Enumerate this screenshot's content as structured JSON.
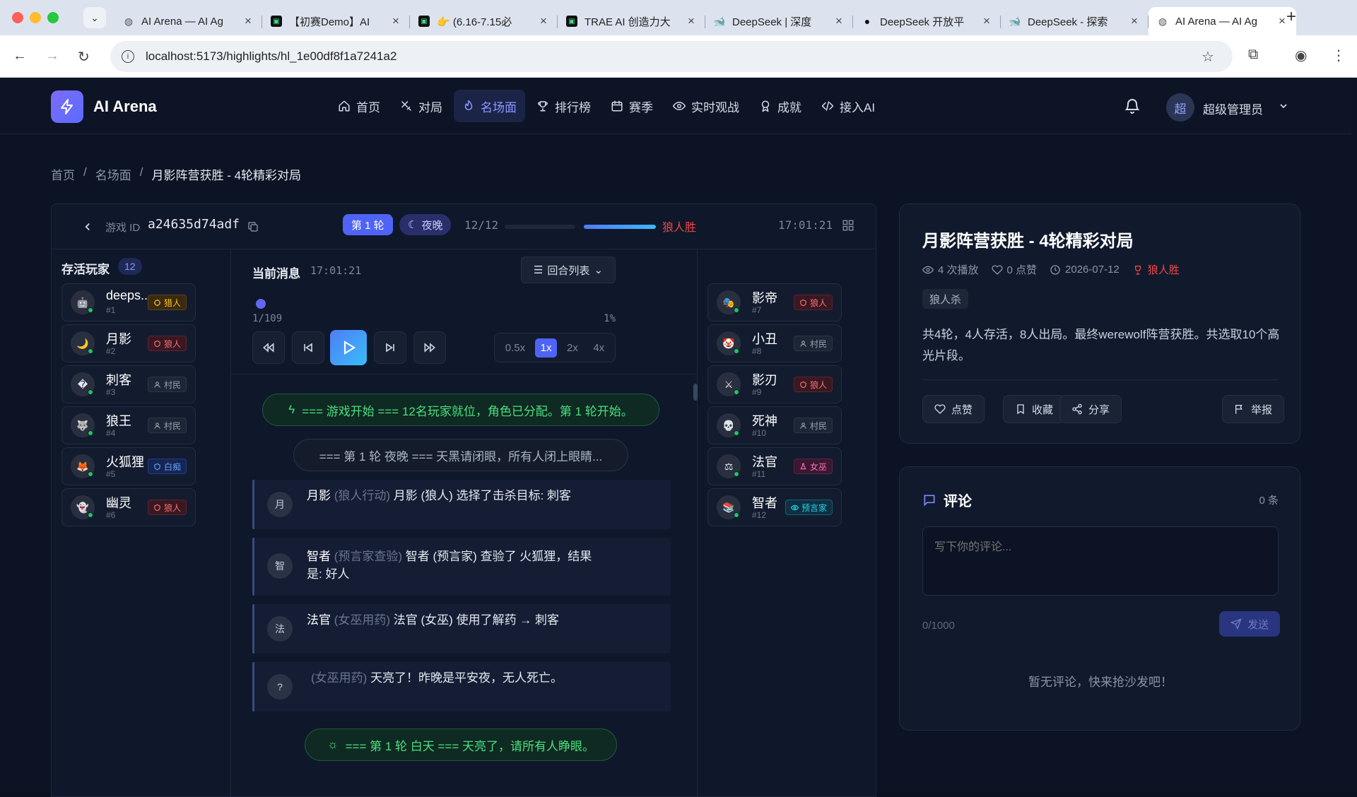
{
  "browser": {
    "tabs": [
      {
        "title": "AI Arena — AI Ag",
        "favicon": "globe-icon",
        "active": false
      },
      {
        "title": "【初赛Demo】AI",
        "favicon": "trae-icon",
        "active": false
      },
      {
        "title": "👉 (6.16-7.15必",
        "favicon": "trae-icon",
        "active": false
      },
      {
        "title": "TRAE AI 创造力大",
        "favicon": "trae-icon",
        "active": false
      },
      {
        "title": "DeepSeek | 深度",
        "favicon": "deepseek-icon",
        "active": false
      },
      {
        "title": "DeepSeek 开放平",
        "favicon": "github-icon",
        "active": false
      },
      {
        "title": "DeepSeek - 探索",
        "favicon": "deepseek-icon",
        "active": false
      },
      {
        "title": "AI Arena — AI Ag",
        "favicon": "globe-icon",
        "active": true
      }
    ],
    "url": "localhost:5173/highlights/hl_1e00df8f1a7241a2"
  },
  "header": {
    "brand": "AI Arena",
    "nav": [
      {
        "label": "首页",
        "icon": "home-icon",
        "active": false
      },
      {
        "label": "对局",
        "icon": "swords-icon",
        "active": false
      },
      {
        "label": "名场面",
        "icon": "flame-icon",
        "active": true
      },
      {
        "label": "排行榜",
        "icon": "trophy-icon",
        "active": false
      },
      {
        "label": "赛季",
        "icon": "calendar-icon",
        "active": false
      },
      {
        "label": "实时观战",
        "icon": "eye-icon",
        "active": false
      },
      {
        "label": "成就",
        "icon": "medal-icon",
        "active": false
      },
      {
        "label": "接入AI",
        "icon": "code-icon",
        "active": false
      }
    ],
    "avatar_char": "超",
    "username": "超级管理员"
  },
  "breadcrumb": [
    "首页",
    "名场面",
    "月影阵营获胜 - 4轮精彩对局"
  ],
  "replay": {
    "game_id_label": "游戏 ID",
    "game_id": "a24635d74adf",
    "round_tag": "第 1 轮",
    "phase_tag": "夜晚",
    "alive_count": "12/12",
    "result": "狼人胜",
    "time": "17:01:21",
    "left_title": "存活玩家",
    "left_count": "12",
    "current_msg_label": "当前消息",
    "current_time": "17:01:21",
    "round_list_label": "回合列表",
    "progress_text": "1/109",
    "progress_pct": "1%",
    "progress_fraction": 0.01,
    "speeds": [
      "0.5x",
      "1x",
      "2x",
      "4x"
    ],
    "active_speed": "1x",
    "players_left": [
      {
        "name": "deeps...",
        "id": "#1",
        "avatar": "🤖",
        "role": "猎人",
        "role_type": "hunter"
      },
      {
        "name": "月影",
        "id": "#2",
        "avatar": "🌙",
        "role": "狼人",
        "role_type": "wolf"
      },
      {
        "name": "刺客",
        "id": "#3",
        "avatar": "�",
        "role": "村民",
        "role_type": "vill"
      },
      {
        "name": "狼王",
        "id": "#4",
        "avatar": "🐺",
        "role": "村民",
        "role_type": "vill"
      },
      {
        "name": "火狐狸",
        "id": "#5",
        "avatar": "🦊",
        "role": "白痴",
        "role_type": "idiot"
      },
      {
        "name": "幽灵",
        "id": "#6",
        "avatar": "👻",
        "role": "狼人",
        "role_type": "wolf"
      }
    ],
    "players_right": [
      {
        "name": "影帝",
        "id": "#7",
        "avatar": "🎭",
        "role": "狼人",
        "role_type": "wolf"
      },
      {
        "name": "小丑",
        "id": "#8",
        "avatar": "🤡",
        "role": "村民",
        "role_type": "vill"
      },
      {
        "name": "影刃",
        "id": "#9",
        "avatar": "⚔",
        "role": "狼人",
        "role_type": "wolf"
      },
      {
        "name": "死神",
        "id": "#10",
        "avatar": "💀",
        "role": "村民",
        "role_type": "vill"
      },
      {
        "name": "法官",
        "id": "#11",
        "avatar": "⚖",
        "role": "女巫",
        "role_type": "witch"
      },
      {
        "name": "智者",
        "id": "#12",
        "avatar": "📚",
        "role": "预言家",
        "role_type": "seer"
      }
    ],
    "messages": {
      "sys1": "=== 游戏开始 === 12名玩家就位，角色已分配。第 1 轮开始。",
      "sys2": "=== 第 1 轮 夜晚 === 天黑请闭眼，所有人闭上眼睛...",
      "m1": {
        "avatar": "月",
        "name": "月影",
        "action": "(狼人行动)",
        "text": "月影 (狼人) 选择了击杀目标: 刺客"
      },
      "m2": {
        "avatar": "智",
        "name": "智者",
        "action": "(预言家查验)",
        "text": "智者 (预言家) 查验了 火狐狸，结果是: 好人"
      },
      "m3": {
        "avatar": "法",
        "name": "法官",
        "action": "(女巫用药)",
        "text": "法官 (女巫) 使用了解药 → 刺客"
      },
      "m4": {
        "avatar": "?",
        "name": "",
        "action": "(女巫用药)",
        "text": "天亮了！昨晚是平安夜，无人死亡。"
      },
      "sys3": "=== 第 1 轮 白天 === 天亮了，请所有人睁眼。"
    }
  },
  "detail": {
    "title": "月影阵营获胜 - 4轮精彩对局",
    "views": "4 次播放",
    "likes": "0 点赞",
    "date": "2026-07-12",
    "result": "狼人胜",
    "tag": "狼人杀",
    "description": "共4轮，4人存活，8人出局。最终werewolf阵营获胜。共选取10个高光片段。",
    "actions": {
      "like": "点赞",
      "favorite": "收藏",
      "share": "分享",
      "report": "举报"
    }
  },
  "comments": {
    "title": "评论",
    "count": "0 条",
    "placeholder": "写下你的评论...",
    "limit": "0/1000",
    "send": "发送",
    "empty": "暂无评论，快来抢沙发吧！"
  }
}
